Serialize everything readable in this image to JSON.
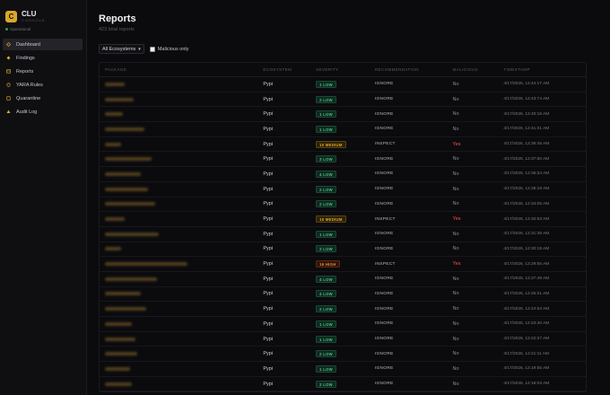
{
  "app": {
    "name": "CLU",
    "subtitle": "CONSOLE",
    "status": "Operational",
    "accent": "#d8a828",
    "logo_letter": "C"
  },
  "nav": [
    {
      "label": "Dashboard",
      "icon": "dashboard-icon"
    },
    {
      "label": "Findings",
      "icon": "findings-icon"
    },
    {
      "label": "Reports",
      "icon": "reports-icon",
      "active": true
    },
    {
      "label": "YARA Rules",
      "icon": "yara-icon"
    },
    {
      "label": "Quarantine",
      "icon": "quarantine-icon"
    },
    {
      "label": "Audit Log",
      "icon": "audit-log-icon"
    }
  ],
  "page": {
    "title": "Reports",
    "subtitle": "423 total reports"
  },
  "filters": {
    "ecosystem": "All Ecosystems",
    "malicious_only_label": "Malicious only",
    "malicious_only_checked": false
  },
  "table": {
    "headers": [
      "PACKAGE",
      "ECOSYSTEM",
      "SEVERITY",
      "RECOMMENDATION",
      "MALICIOUS",
      "TIMESTAMP"
    ],
    "rows": [
      {
        "ecosystem": "Pypi",
        "severity": "1 LOW",
        "level": "low",
        "recommendation": "IGNORE",
        "malicious": "No",
        "timestamp": "4/17/2026, 12:44:17 AM"
      },
      {
        "ecosystem": "Pypi",
        "severity": "2 LOW",
        "level": "low",
        "recommendation": "IGNORE",
        "malicious": "No",
        "timestamp": "4/17/2026, 12:43:74 AM"
      },
      {
        "ecosystem": "Pypi",
        "severity": "1 LOW",
        "level": "low",
        "recommendation": "IGNORE",
        "malicious": "No",
        "timestamp": "4/17/2026, 12:40:16 AM"
      },
      {
        "ecosystem": "Pypi",
        "severity": "1 LOW",
        "level": "low",
        "recommendation": "IGNORE",
        "malicious": "No",
        "timestamp": "4/17/2026, 12:41:31 AM"
      },
      {
        "ecosystem": "Pypi",
        "severity": "10 MEDIUM",
        "level": "med",
        "recommendation": "INSPECT",
        "malicious": "Yes",
        "timestamp": "4/17/2026, 12:36:45 AM"
      },
      {
        "ecosystem": "Pypi",
        "severity": "3 LOW",
        "level": "low",
        "recommendation": "IGNORE",
        "malicious": "No",
        "timestamp": "4/17/2026, 12:37:50 AM"
      },
      {
        "ecosystem": "Pypi",
        "severity": "4 LOW",
        "level": "low",
        "recommendation": "IGNORE",
        "malicious": "No",
        "timestamp": "4/17/2026, 12:36:34 AM"
      },
      {
        "ecosystem": "Pypi",
        "severity": "2 LOW",
        "level": "low",
        "recommendation": "IGNORE",
        "malicious": "No",
        "timestamp": "4/17/2026, 12:35:18 AM"
      },
      {
        "ecosystem": "Pypi",
        "severity": "2 LOW",
        "level": "low",
        "recommendation": "IGNORE",
        "malicious": "No",
        "timestamp": "4/17/2026, 12:34:05 AM"
      },
      {
        "ecosystem": "Pypi",
        "severity": "10 MEDIUM",
        "level": "med",
        "recommendation": "INSPECT",
        "malicious": "Yes",
        "timestamp": "4/17/2026, 12:32:53 AM"
      },
      {
        "ecosystem": "Pypi",
        "severity": "1 LOW",
        "level": "low",
        "recommendation": "IGNORE",
        "malicious": "No",
        "timestamp": "4/17/2026, 12:31:36 AM"
      },
      {
        "ecosystem": "Pypi",
        "severity": "2 LOW",
        "level": "low",
        "recommendation": "IGNORE",
        "malicious": "No",
        "timestamp": "4/17/2026, 12:30:19 AM"
      },
      {
        "ecosystem": "Pypi",
        "severity": "16 HIGH",
        "level": "high",
        "recommendation": "INSPECT",
        "malicious": "Yes",
        "timestamp": "4/17/2026, 12:29:55 AM"
      },
      {
        "ecosystem": "Pypi",
        "severity": "4 LOW",
        "level": "low",
        "recommendation": "IGNORE",
        "malicious": "No",
        "timestamp": "4/17/2026, 12:27:49 AM"
      },
      {
        "ecosystem": "Pypi",
        "severity": "4 LOW",
        "level": "low",
        "recommendation": "IGNORE",
        "malicious": "No",
        "timestamp": "4/17/2026, 12:26:21 AM"
      },
      {
        "ecosystem": "Pypi",
        "severity": "2 LOW",
        "level": "low",
        "recommendation": "IGNORE",
        "malicious": "No",
        "timestamp": "4/17/2026, 12:24:54 AM"
      },
      {
        "ecosystem": "Pypi",
        "severity": "1 LOW",
        "level": "low",
        "recommendation": "IGNORE",
        "malicious": "No",
        "timestamp": "4/17/2026, 12:23:40 AM"
      },
      {
        "ecosystem": "Pypi",
        "severity": "1 LOW",
        "level": "low",
        "recommendation": "IGNORE",
        "malicious": "No",
        "timestamp": "4/17/2026, 12:22:27 AM"
      },
      {
        "ecosystem": "Pypi",
        "severity": "2 LOW",
        "level": "low",
        "recommendation": "IGNORE",
        "malicious": "No",
        "timestamp": "4/17/2026, 12:21:11 AM"
      },
      {
        "ecosystem": "Pypi",
        "severity": "1 LOW",
        "level": "low",
        "recommendation": "IGNORE",
        "malicious": "No",
        "timestamp": "4/17/2026, 12:19:55 AM"
      },
      {
        "ecosystem": "Pypi",
        "severity": "2 LOW",
        "level": "low",
        "recommendation": "IGNORE",
        "malicious": "No",
        "timestamp": "4/17/2026, 12:18:03 AM"
      }
    ]
  }
}
